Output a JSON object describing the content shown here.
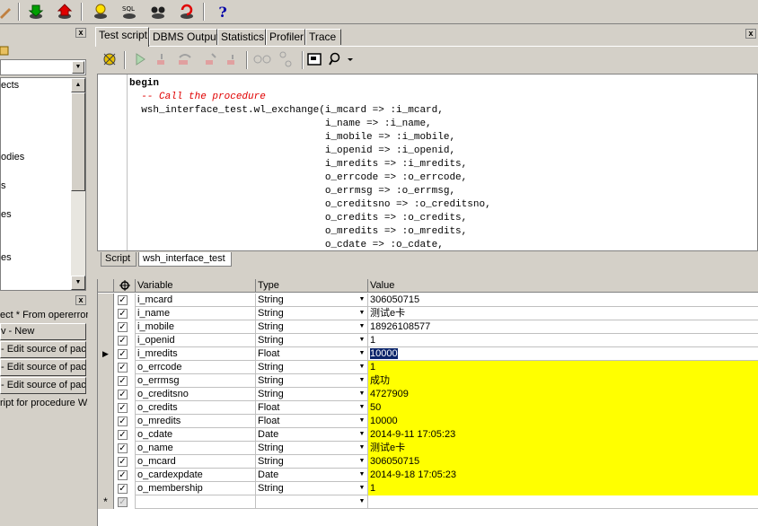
{
  "toolbar": {
    "icons": [
      "green-download-icon",
      "red-upload-icon",
      "bulb-icon",
      "sql-icon",
      "binoculars-icon",
      "refresh-db-icon",
      "help-icon"
    ],
    "help_label": "?"
  },
  "left_panel": {
    "close": "x",
    "list_items": [
      "ects",
      "odies",
      "s",
      "es",
      "es"
    ],
    "windows": [
      "ect * From opererrors",
      "v - New",
      "- Edit source of pack",
      "- Edit source of pack",
      "- Edit source of pack",
      "ript for procedure WS"
    ]
  },
  "tabs": [
    "Test script",
    "DBMS Output",
    "Statistics",
    "Profiler",
    "Trace"
  ],
  "code_lines": [
    {
      "kind": "kw",
      "text": "begin"
    },
    {
      "kind": "cm",
      "text": "  -- Call the procedure"
    },
    {
      "kind": "tx",
      "text": "  wsh_interface_test.wl_exchange(i_mcard => :i_mcard,"
    },
    {
      "kind": "tx",
      "text": "                                 i_name => :i_name,"
    },
    {
      "kind": "tx",
      "text": "                                 i_mobile => :i_mobile,"
    },
    {
      "kind": "tx",
      "text": "                                 i_openid => :i_openid,"
    },
    {
      "kind": "tx",
      "text": "                                 i_mredits => :i_mredits,"
    },
    {
      "kind": "tx",
      "text": "                                 o_errcode => :o_errcode,"
    },
    {
      "kind": "tx",
      "text": "                                 o_errmsg => :o_errmsg,"
    },
    {
      "kind": "tx",
      "text": "                                 o_creditsno => :o_creditsno,"
    },
    {
      "kind": "tx",
      "text": "                                 o_credits => :o_credits,"
    },
    {
      "kind": "tx",
      "text": "                                 o_mredits => :o_mredits,"
    },
    {
      "kind": "tx",
      "text": "                                 o_cdate => :o_cdate,"
    }
  ],
  "subtabs": [
    "Script",
    "wsh_interface_test"
  ],
  "grid": {
    "headers": {
      "variable": "Variable",
      "type": "Type",
      "value": "Value"
    },
    "rows": [
      {
        "variable": "i_mcard",
        "type": "String",
        "value": "306050715",
        "output": false
      },
      {
        "variable": "i_name",
        "type": "String",
        "value": "测试e卡",
        "output": false
      },
      {
        "variable": "i_mobile",
        "type": "String",
        "value": "18926108577",
        "output": false
      },
      {
        "variable": "i_openid",
        "type": "String",
        "value": "1",
        "output": false
      },
      {
        "variable": "i_mredits",
        "type": "Float",
        "value": "10000",
        "output": false,
        "current": true
      },
      {
        "variable": "o_errcode",
        "type": "String",
        "value": "1",
        "output": true
      },
      {
        "variable": "o_errmsg",
        "type": "String",
        "value": "成功",
        "output": true
      },
      {
        "variable": "o_creditsno",
        "type": "String",
        "value": "4727909",
        "output": true
      },
      {
        "variable": "o_credits",
        "type": "Float",
        "value": "50",
        "output": true
      },
      {
        "variable": "o_mredits",
        "type": "Float",
        "value": "10000",
        "output": true
      },
      {
        "variable": "o_cdate",
        "type": "Date",
        "value": "2014-9-11 17:05:23",
        "output": true
      },
      {
        "variable": "o_name",
        "type": "String",
        "value": "测试e卡",
        "output": true
      },
      {
        "variable": "o_mcard",
        "type": "String",
        "value": "306050715",
        "output": true
      },
      {
        "variable": "o_cardexpdate",
        "type": "Date",
        "value": "2014-9-18 17:05:23",
        "output": true
      },
      {
        "variable": "o_membership",
        "type": "String",
        "value": "1",
        "output": true
      }
    ],
    "new_row_marker": "*"
  },
  "colors": {
    "face": "#d4d0c8",
    "output_highlight": "#ffff00",
    "selection": "#0a246a",
    "comment": "#e00000"
  }
}
